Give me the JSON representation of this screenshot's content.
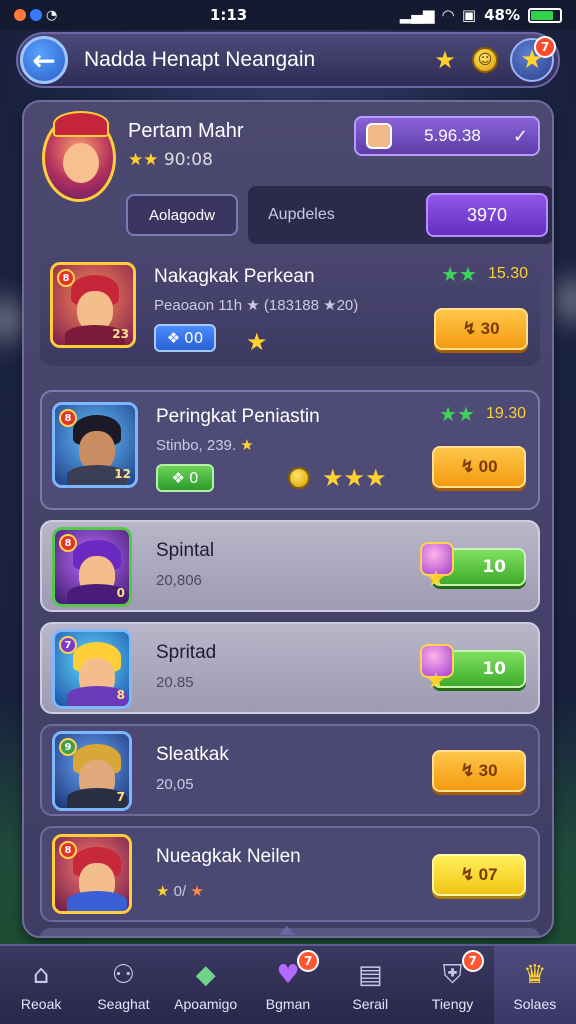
{
  "status_bar": {
    "time": "1:13",
    "battery": "48%"
  },
  "header": {
    "title": "Nadda Henapt Neangain",
    "notification_count": "7"
  },
  "profile": {
    "name": "Pertam Mahr",
    "stats": "90:08",
    "currency_value": "5.96.38",
    "tab_left": "Aolagodw",
    "tab_mid": "Aupdeles",
    "tab_value": "3970"
  },
  "rows": [
    {
      "name": "Nakagkak Perkean",
      "sub": "Peaoaon 11h ★ (183188 ★20)",
      "badge": "8",
      "level": "23",
      "stars_value": "15.30",
      "chip": "00",
      "button": "30"
    },
    {
      "name": "Peringkat Peniastin",
      "sub": "Stinbo, 239.",
      "badge": "8",
      "level": "12",
      "stars_value": "19.30",
      "chip": "0",
      "button": "00"
    },
    {
      "name": "Spintal",
      "sub": "20,806",
      "badge": "8",
      "level": "0",
      "button": "10"
    },
    {
      "name": "Spritad",
      "sub": "20.85",
      "badge": "7",
      "level": "8",
      "button": "10"
    },
    {
      "name": "Sleatkak",
      "sub": "20,05",
      "badge": "9",
      "level": "7",
      "button": "30"
    },
    {
      "name": "Nueagkak Neilen",
      "sub": "0/",
      "badge": "8",
      "level": "",
      "button": "07"
    }
  ],
  "bottom_nav": [
    {
      "label": "Reoak",
      "icon": "home-icon"
    },
    {
      "label": "Seaghat",
      "icon": "team-icon"
    },
    {
      "label": "Apoamigo",
      "icon": "chest-icon"
    },
    {
      "label": "Bgman",
      "icon": "heart-icon",
      "notification": "7"
    },
    {
      "label": "Serail",
      "icon": "card-icon"
    },
    {
      "label": "Tiengy",
      "icon": "shield-icon",
      "notification": "7"
    },
    {
      "label": "Solaes",
      "icon": "crown-icon"
    }
  ],
  "colors": {
    "accent_purple": "#6430c2",
    "button_orange": "#f39a10",
    "button_green": "#3fab2c",
    "star_gold": "#ffd22e"
  }
}
